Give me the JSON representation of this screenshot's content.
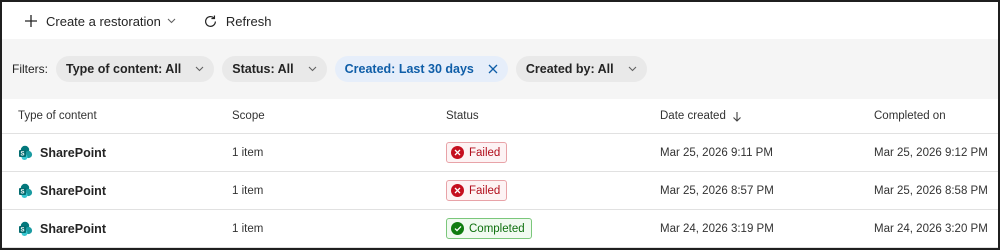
{
  "toolbar": {
    "create_label": "Create a restoration",
    "refresh_label": "Refresh"
  },
  "filters": {
    "label": "Filters:",
    "type_of_content": "Type of content: All",
    "status": "Status: All",
    "created": "Created: Last 30 days",
    "created_by": "Created by: All"
  },
  "table": {
    "columns": [
      "Type of content",
      "Scope",
      "Status",
      "Date created",
      "Completed on"
    ],
    "rows": [
      {
        "type": "SharePoint",
        "scope": "1 item",
        "status": "Failed",
        "date_created": "Mar 25, 2026 9:11 PM",
        "completed_on": "Mar 25, 2026 9:12 PM"
      },
      {
        "type": "SharePoint",
        "scope": "1 item",
        "status": "Failed",
        "date_created": "Mar 25, 2026 8:57 PM",
        "completed_on": "Mar 25, 2026 8:58 PM"
      },
      {
        "type": "SharePoint",
        "scope": "1 item",
        "status": "Completed",
        "date_created": "Mar 24, 2026 3:19 PM",
        "completed_on": "Mar 24, 2026 3:20 PM"
      }
    ]
  },
  "colors": {
    "failed": "#c50f1f",
    "completed": "#107c10",
    "active_filter": "#0f5ea8",
    "sharepoint": "#03787c"
  },
  "icons": {
    "create": "plus-icon",
    "refresh": "refresh-icon",
    "sort": "arrow-down-icon",
    "row_type": "sharepoint-icon"
  }
}
